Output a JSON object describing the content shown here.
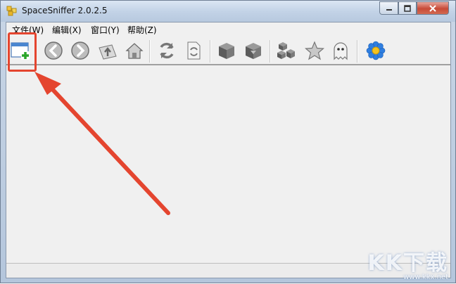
{
  "window": {
    "title": "SpaceSniffer 2.0.2.5",
    "controls": {
      "minimize_icon": "minimize-icon",
      "maximize_icon": "maximize-icon",
      "close_icon": "close-icon"
    }
  },
  "menu": {
    "items": [
      {
        "label": "文件(W)"
      },
      {
        "label": "编辑(X)"
      },
      {
        "label": "窗口(Y)"
      },
      {
        "label": "帮助(Z)"
      }
    ]
  },
  "toolbar": {
    "buttons": [
      {
        "icon": "new-window-icon"
      },
      {
        "icon": "back-icon"
      },
      {
        "icon": "forward-icon"
      },
      {
        "icon": "up-folder-icon"
      },
      {
        "icon": "home-icon"
      },
      {
        "icon": "refresh-icon"
      },
      {
        "icon": "refresh-document-icon"
      },
      {
        "icon": "cube-icon"
      },
      {
        "icon": "cube-filter-icon"
      },
      {
        "icon": "cubes-icon"
      },
      {
        "icon": "star-icon"
      },
      {
        "icon": "ghost-icon"
      },
      {
        "icon": "flower-icon"
      }
    ]
  },
  "annotation": {
    "color": "#e4452f"
  },
  "watermark": {
    "brand": "KK下载",
    "url": "www.kkx.net"
  }
}
